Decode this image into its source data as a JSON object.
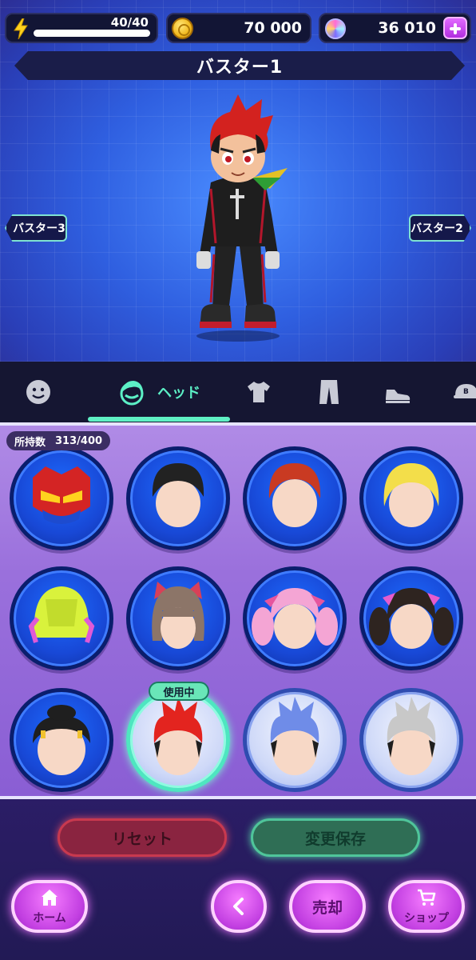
{
  "resources": {
    "energy": {
      "text": "40/40",
      "current": 40,
      "max": 40,
      "icon": "lightning-bolt-icon"
    },
    "coins": {
      "value": "70 000",
      "icon": "coin-icon"
    },
    "gems": {
      "value": "36 010",
      "icon": "gem-icon",
      "add_icon": "plus-icon"
    }
  },
  "character": {
    "name": "バスター1"
  },
  "navigation": {
    "previous": "バスター3",
    "next": "バスター2"
  },
  "category_tabs": {
    "items": [
      {
        "id": "face",
        "icon": "face-icon"
      },
      {
        "id": "head",
        "icon": "hair-icon",
        "label": "ヘッド",
        "active": true
      },
      {
        "id": "top",
        "icon": "shirt-icon"
      },
      {
        "id": "bottom",
        "icon": "pants-icon"
      },
      {
        "id": "shoes",
        "icon": "shoe-icon"
      },
      {
        "id": "cap",
        "icon": "cap-icon"
      }
    ]
  },
  "inventory": {
    "owned_label": "所持数",
    "owned_count": "313/400",
    "in_use_label": "使用中",
    "items": [
      {
        "name": "hero-mask",
        "style": "dark"
      },
      {
        "name": "black-short-hair",
        "style": "dark"
      },
      {
        "name": "red-short-hair",
        "style": "dark"
      },
      {
        "name": "blonde-hair",
        "style": "dark"
      },
      {
        "name": "yellow-helmet",
        "style": "dark"
      },
      {
        "name": "cat-ear-bob",
        "style": "dark"
      },
      {
        "name": "pink-twintails",
        "style": "dark"
      },
      {
        "name": "black-twintails",
        "style": "dark"
      },
      {
        "name": "black-bun-hair",
        "style": "dark"
      },
      {
        "name": "red-spiky-hair",
        "style": "light",
        "in_use": true
      },
      {
        "name": "blue-spiky-hair",
        "style": "light"
      },
      {
        "name": "silver-spiky-hair",
        "style": "light"
      }
    ]
  },
  "actions": {
    "reset": "リセット",
    "save": "変更保存"
  },
  "bottom_nav": {
    "home": {
      "label": "ホーム",
      "icon": "home-icon"
    },
    "back": {
      "icon": "chevron-left-icon"
    },
    "sell": {
      "label": "売却"
    },
    "shop": {
      "label": "ショップ",
      "icon": "cart-icon"
    }
  },
  "colors": {
    "accent_teal": "#5ff0c4",
    "panel_purple": "#9a70dc",
    "button_pink": "#d24fe8",
    "slot_blue": "#1848d6"
  }
}
